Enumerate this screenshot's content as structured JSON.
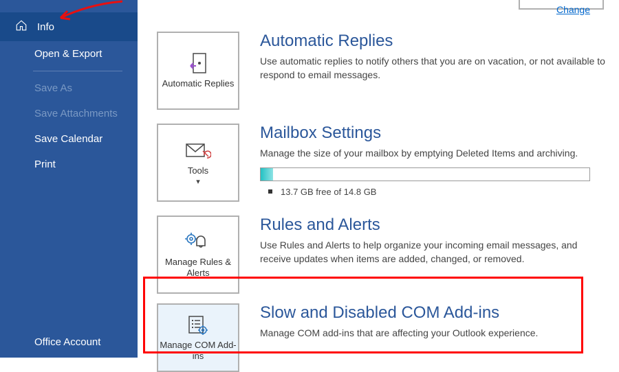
{
  "sidebar": {
    "info": "Info",
    "open_export": "Open & Export",
    "save_as": "Save As",
    "save_attachments": "Save Attachments",
    "save_calendar": "Save Calendar",
    "print": "Print",
    "office_account": "Office Account"
  },
  "top": {
    "change": "Change"
  },
  "auto_replies": {
    "tile": "Automatic Replies",
    "title": "Automatic Replies",
    "desc": "Use automatic replies to notify others that you are on vacation, or not available to respond to email messages."
  },
  "mailbox": {
    "tile": "Tools",
    "title": "Mailbox Settings",
    "desc": "Manage the size of your mailbox by emptying Deleted Items and archiving.",
    "storage": "13.7 GB free of 14.8 GB"
  },
  "rules": {
    "tile": "Manage Rules & Alerts",
    "title": "Rules and Alerts",
    "desc": "Use Rules and Alerts to help organize your incoming email messages, and receive updates when items are added, changed, or removed."
  },
  "addins": {
    "tile": "Manage COM Add-ins",
    "title": "Slow and Disabled COM Add-ins",
    "desc": "Manage COM add-ins that are affecting your Outlook experience."
  }
}
